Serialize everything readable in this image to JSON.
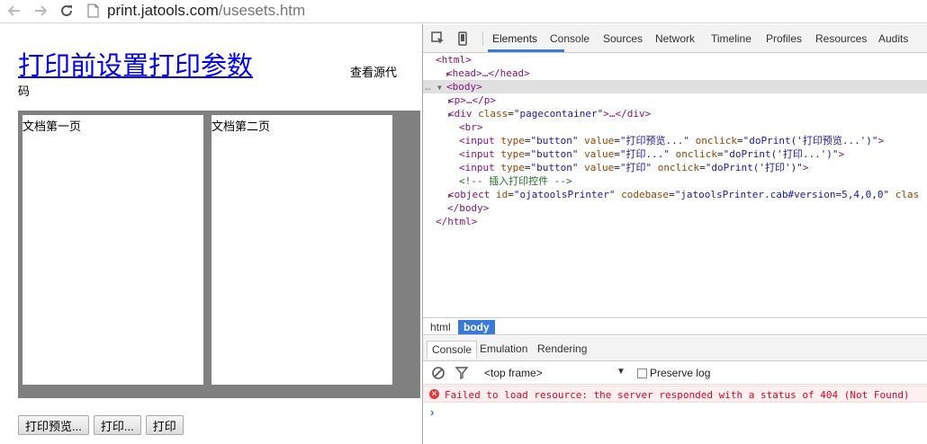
{
  "browser": {
    "url_host": "print.jatools.com",
    "url_path": "/usesets.htm"
  },
  "page": {
    "title": "打印前设置打印参数",
    "source_link_a": "查看源代",
    "source_link_b": "码",
    "sheets": [
      "文档第一页",
      "文档第二页"
    ],
    "buttons": [
      "打印预览...",
      "打印...",
      "打印"
    ]
  },
  "devtools": {
    "tabs": [
      "Elements",
      "Console",
      "Sources",
      "Network",
      "Timeline",
      "Profiles",
      "Resources",
      "Audits"
    ],
    "active_tab": "Elements",
    "dom": {
      "html_open": "<html>",
      "head": "<head>…</head>",
      "body_open": "<body>",
      "p": "<p>…</p>",
      "div_tag": "div",
      "div_attr": "class",
      "div_val": "\"pagecontainer\"",
      "div_tail": ">…</div>",
      "br": "<br>",
      "input1_value": "\"打印预览...\"",
      "input1_onclick": "\"doPrint('打印预览...')\"",
      "input2_value": "\"打印...\"",
      "input2_onclick": "\"doPrint('打印...')\"",
      "input3_value": "\"打印\"",
      "input3_onclick": "\"doPrint('打印')\"",
      "comment": "<!-- 插入打印控件 -->",
      "object_id": "\"ojatoolsPrinter\"",
      "object_codebase": "\"jatoolsPrinter.cab#version=5,4,0,0\"",
      "object_tail": "clas",
      "body_close": "</body>",
      "html_close": "</html>"
    },
    "breadcrumbs": [
      "html",
      "body"
    ],
    "drawer_tabs": [
      "Console",
      "Emulation",
      "Rendering"
    ],
    "frame": "<top frame>",
    "preserve_log": "Preserve log",
    "error": "Failed to load resource: the server responded with a status of 404 (Not Found)",
    "colors": {
      "accent": "#3879d9",
      "error": "#e8002a",
      "tag": "#881280"
    }
  }
}
